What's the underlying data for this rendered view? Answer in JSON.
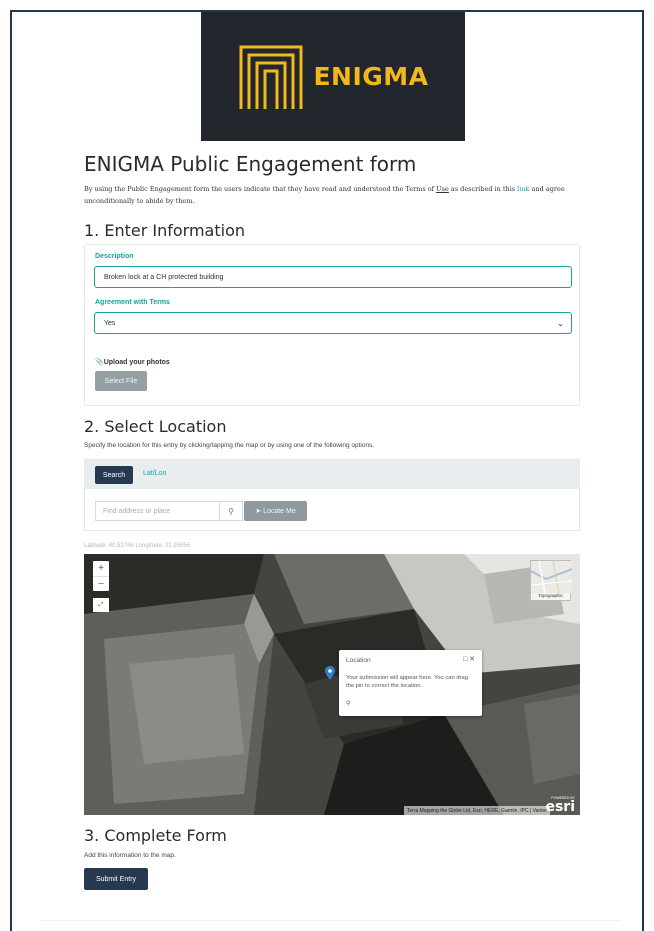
{
  "logo": {
    "text": "ENIGMA",
    "color": "#f2b81d",
    "background": "#22262d"
  },
  "page": {
    "title": "ENIGMA Public Engagement form",
    "intro_part1": "By using the Public Engagement form the  users indicate that they have read and understood the Terms of ",
    "intro_link_use": "Use",
    "intro_part2": " as described in this ",
    "intro_link": "link",
    "intro_part3": " and agree unconditionally to abide by them."
  },
  "section1": {
    "heading": "1. Enter Information",
    "description_label": "Description",
    "description_value": "Broken lock at a  CH protected building",
    "agreement_label": "Agreement with Terms",
    "agreement_value": "Yes",
    "upload_label": "Upload your photos",
    "select_file_label": "Select File"
  },
  "section2": {
    "heading": "2. Select Location",
    "instructions": "Specify the location for this entry by clicking/tapping the map or by using one of the following options.",
    "tab_search": "Search",
    "tab_latlon": "Lat/Lon",
    "find_placeholder": "Find address or place",
    "locate_label": "Locate Me",
    "coords": "Latitude: 40.52746   Longitude: 22.95856"
  },
  "map": {
    "zoom_in": "+",
    "zoom_out": "−",
    "basemap_label": "Topographic",
    "popup_title": "Location",
    "popup_body": "Your submission will appear here. You can drag the pin to correct the location.",
    "attribution": "Terra Mapping the Globe Ltd, Esri, HERE, Garmin, IPC | Vantor",
    "powered": "POWERED BY",
    "esri": "esri"
  },
  "section3": {
    "heading": "3. Complete Form",
    "instructions": "Add this information to the map.",
    "submit_label": "Submit Entry"
  },
  "colors": {
    "accent": "#1aa39a",
    "primary_dark": "#26394f",
    "disabled_button": "#95a0a6"
  }
}
